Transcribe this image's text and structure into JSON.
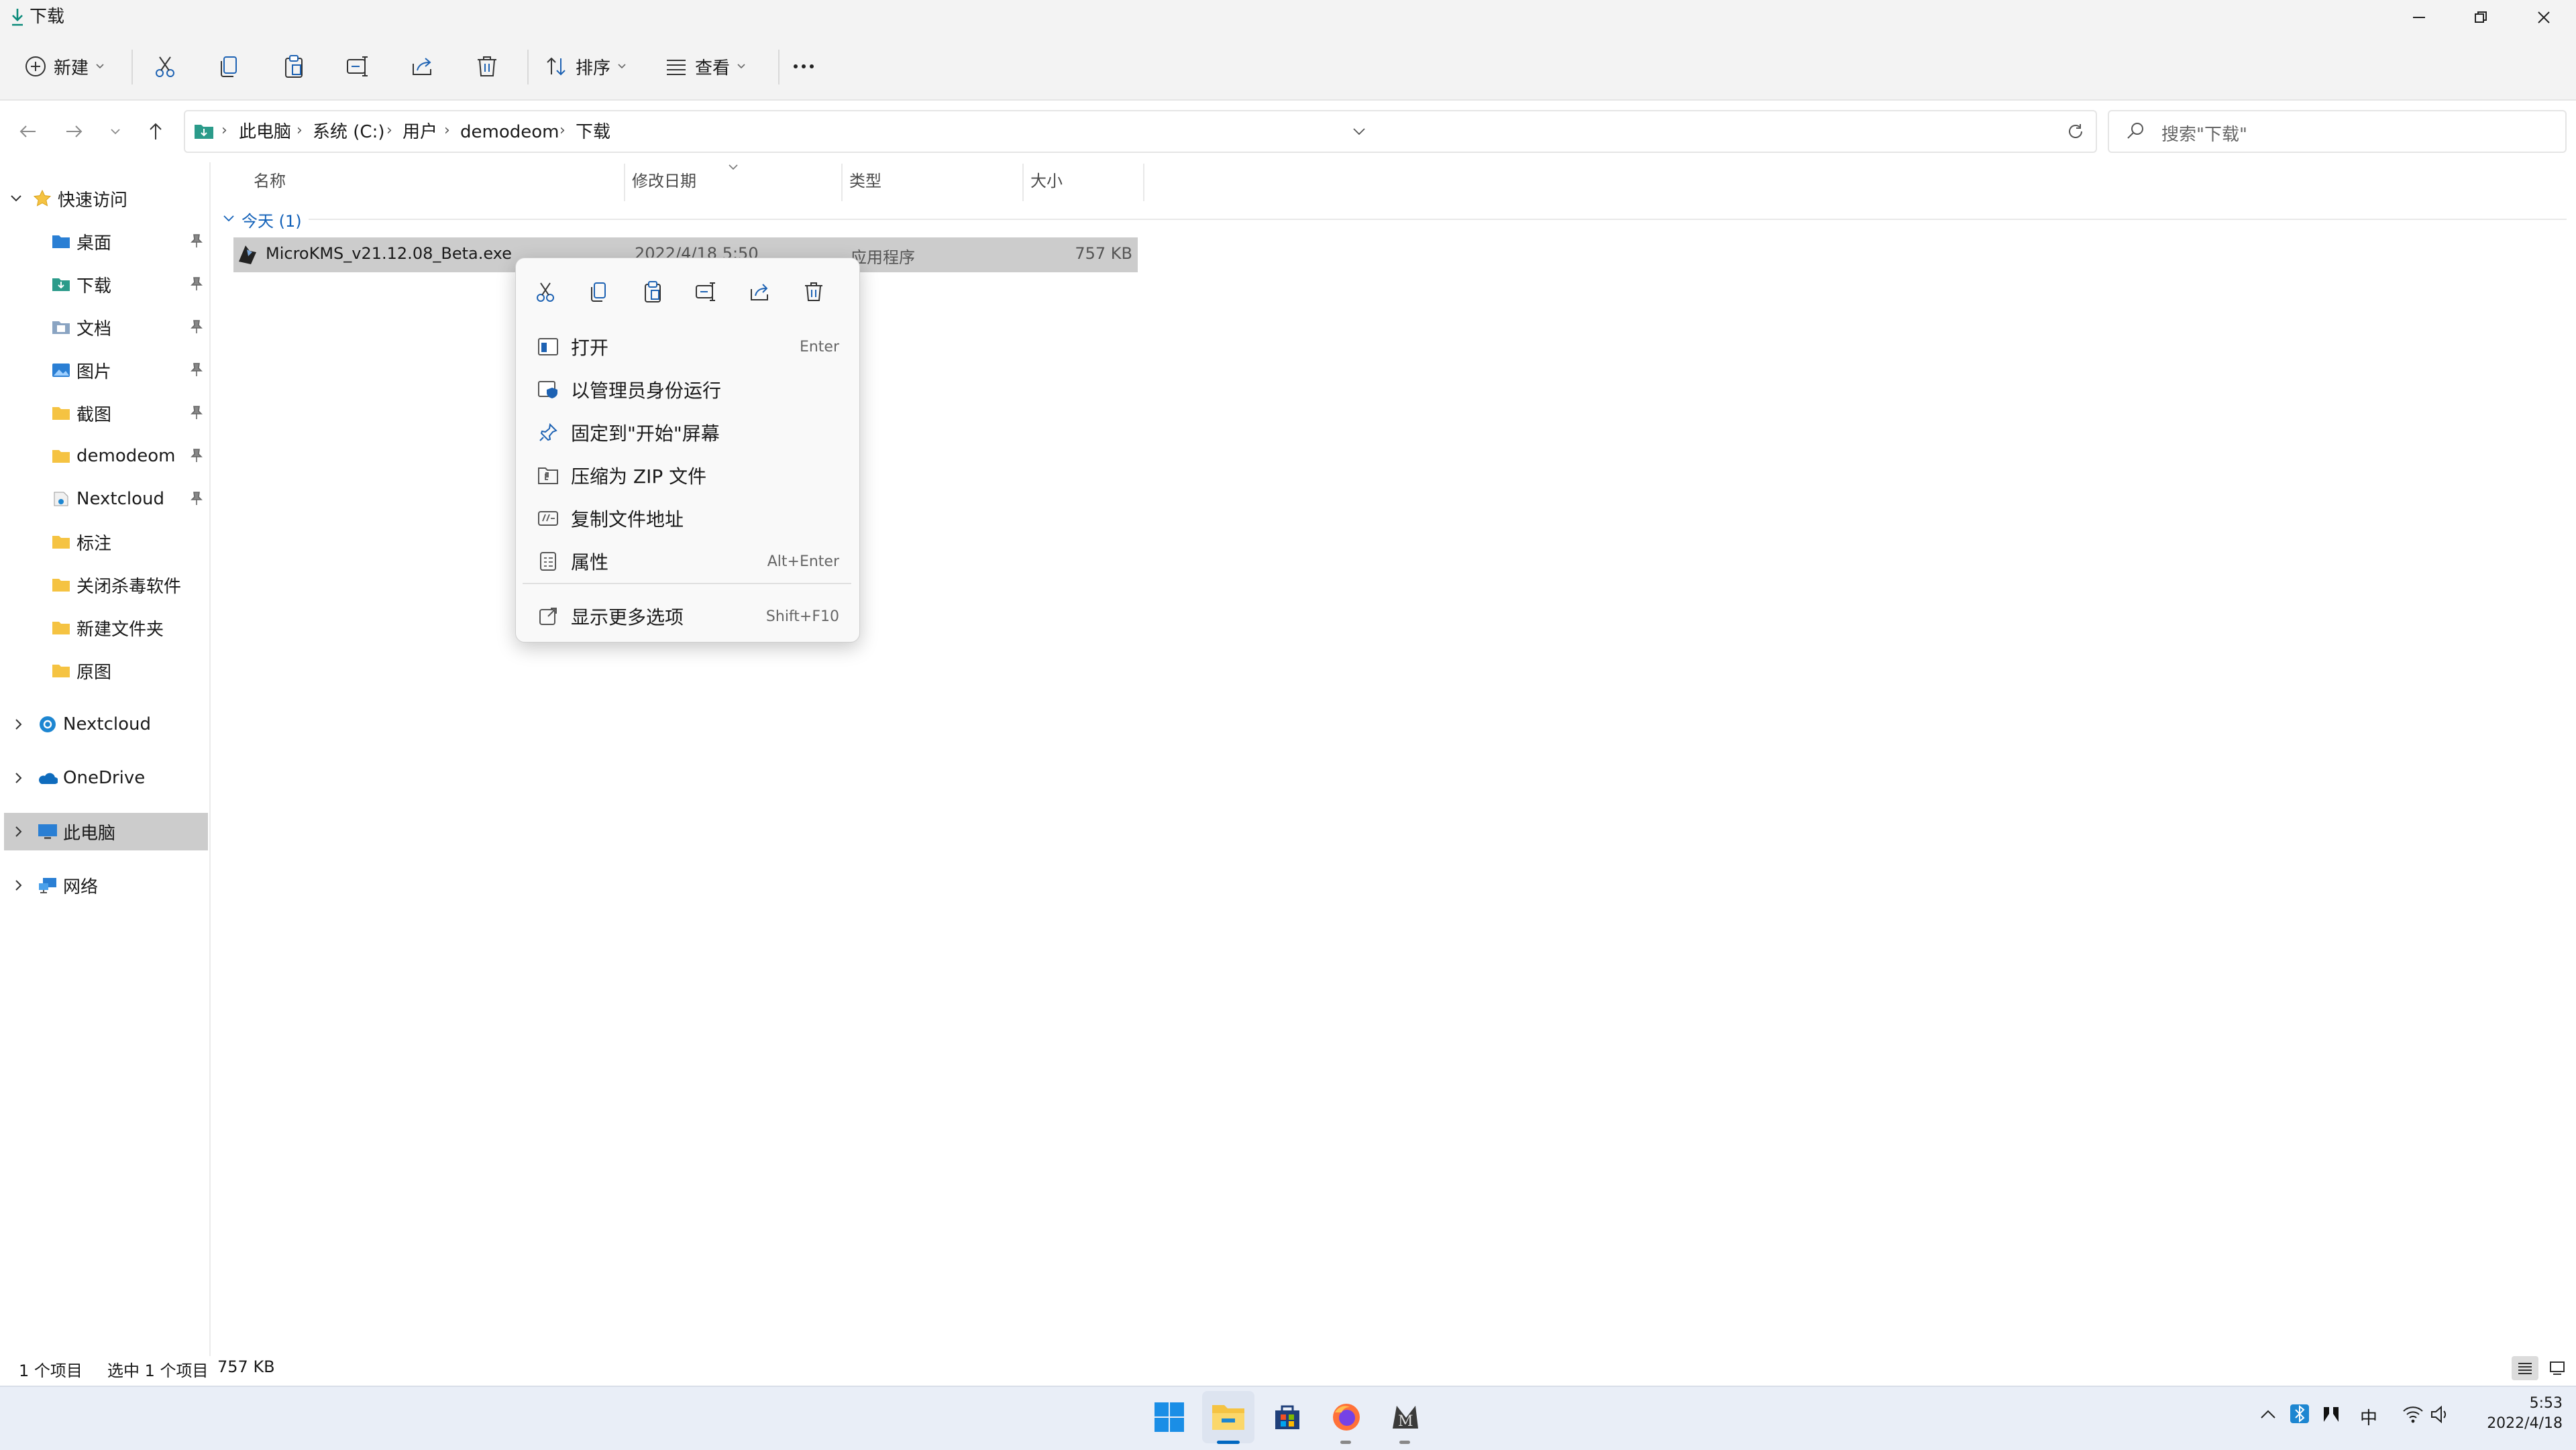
{
  "window": {
    "title": "下载",
    "minimize_icon": "minimize-icon",
    "maximize_icon": "restore-icon",
    "close_icon": "close-icon"
  },
  "toolbar": {
    "new_label": "新建",
    "sort_label": "排序",
    "view_label": "查看",
    "icons": [
      "cut-icon",
      "copy-icon",
      "paste-icon",
      "rename-icon",
      "share-icon",
      "delete-icon",
      "more-icon"
    ]
  },
  "address": {
    "crumbs": [
      "此电脑",
      "系统 (C:)",
      "用户",
      "demodeom",
      "下载"
    ],
    "search_placeholder": "搜索\"下载\""
  },
  "nav": {
    "quick_access_label": "快速访问",
    "quick_items": [
      {
        "label": "桌面",
        "pinned": true
      },
      {
        "label": "下载",
        "pinned": true
      },
      {
        "label": "文档",
        "pinned": true
      },
      {
        "label": "图片",
        "pinned": true
      },
      {
        "label": "截图",
        "pinned": true
      },
      {
        "label": "demodeom",
        "pinned": true
      },
      {
        "label": "Nextcloud",
        "pinned": true
      },
      {
        "label": "标注",
        "pinned": false
      },
      {
        "label": "关闭杀毒软件",
        "pinned": false
      },
      {
        "label": "新建文件夹",
        "pinned": false
      },
      {
        "label": "原图",
        "pinned": false
      }
    ],
    "roots": [
      {
        "label": "Nextcloud"
      },
      {
        "label": "OneDrive"
      },
      {
        "label": "此电脑"
      },
      {
        "label": "网络"
      }
    ]
  },
  "columns": {
    "name": "名称",
    "modified": "修改日期",
    "type": "类型",
    "size": "大小"
  },
  "group": {
    "label": "今天 (1)"
  },
  "file": {
    "name": "MicroKMS_v21.12.08_Beta.exe",
    "modified": "2022/4/18 5:50",
    "type": "应用程序",
    "size": "757 KB"
  },
  "context_menu": {
    "quick_icons": [
      "cut-icon",
      "copy-icon",
      "paste-icon",
      "rename-icon",
      "share-icon",
      "delete-icon"
    ],
    "items": [
      {
        "label": "打开",
        "shortcut": "Enter"
      },
      {
        "label": "以管理员身份运行",
        "shortcut": ""
      },
      {
        "label": "固定到\"开始\"屏幕",
        "shortcut": ""
      },
      {
        "label": "压缩为 ZIP 文件",
        "shortcut": ""
      },
      {
        "label": "复制文件地址",
        "shortcut": ""
      },
      {
        "label": "属性",
        "shortcut": "Alt+Enter"
      },
      {
        "label": "显示更多选项",
        "shortcut": "Shift+F10"
      }
    ]
  },
  "status": {
    "item_count": "1 个项目",
    "selected": "选中 1 个项目",
    "selected_size": "757 KB"
  },
  "taskbar": {
    "apps": [
      "windows-start-icon",
      "file-explorer-icon",
      "store-icon",
      "firefox-icon",
      "app-m-icon"
    ],
    "ime": "中",
    "time": "5:53",
    "date": "2022/4/18"
  },
  "colors": {
    "accent": "#0067c0",
    "selection": "#cccccc",
    "folder": "#f5c342",
    "group_label": "#1160b8"
  }
}
